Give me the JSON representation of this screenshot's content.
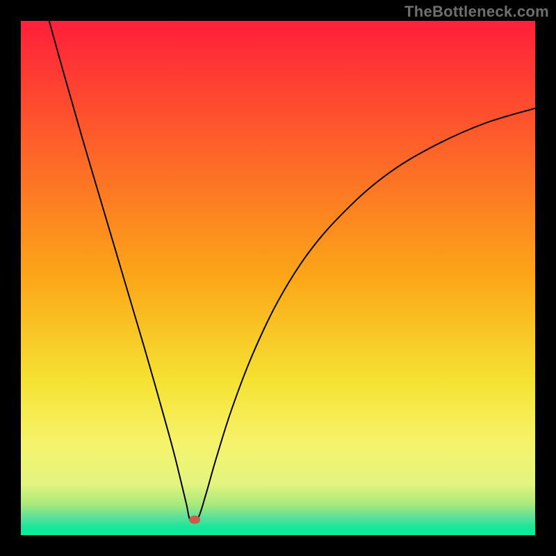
{
  "watermark": "TheBottleneck.com",
  "chart_data": {
    "type": "line",
    "title": "",
    "xlabel": "",
    "ylabel": "",
    "xlim": [
      0,
      100
    ],
    "ylim": [
      0,
      100
    ],
    "grid": false,
    "legend": false,
    "background_gradient": {
      "stops": [
        {
          "offset": 0.0,
          "color": "#ff1f3a"
        },
        {
          "offset": 0.5,
          "color": "#fca718"
        },
        {
          "offset": 0.7,
          "color": "#f5e232"
        },
        {
          "offset": 0.82,
          "color": "#f6f36b"
        },
        {
          "offset": 0.9,
          "color": "#e3f47f"
        },
        {
          "offset": 0.94,
          "color": "#a9e97c"
        },
        {
          "offset": 0.965,
          "color": "#5de09a"
        },
        {
          "offset": 0.985,
          "color": "#17e69b"
        },
        {
          "offset": 1.0,
          "color": "#05f09a"
        }
      ]
    },
    "marker": {
      "x": 33.8,
      "y": 3.0,
      "color": "#d05a4a",
      "rx": 8,
      "ry": 6
    },
    "series": [
      {
        "name": "bottleneck-curve",
        "type": "line",
        "color": "#000000",
        "stroke_width": 2,
        "data": [
          {
            "x": 5.5,
            "y": 100.0
          },
          {
            "x": 8.0,
            "y": 91.0
          },
          {
            "x": 12.0,
            "y": 77.0
          },
          {
            "x": 16.0,
            "y": 63.5
          },
          {
            "x": 20.0,
            "y": 50.0
          },
          {
            "x": 24.0,
            "y": 36.5
          },
          {
            "x": 27.0,
            "y": 26.0
          },
          {
            "x": 29.5,
            "y": 17.0
          },
          {
            "x": 31.0,
            "y": 11.0
          },
          {
            "x": 32.2,
            "y": 6.0
          },
          {
            "x": 32.8,
            "y": 3.2
          },
          {
            "x": 33.6,
            "y": 2.8
          },
          {
            "x": 34.6,
            "y": 3.6
          },
          {
            "x": 36.0,
            "y": 8.0
          },
          {
            "x": 38.0,
            "y": 15.0
          },
          {
            "x": 41.0,
            "y": 24.5
          },
          {
            "x": 45.0,
            "y": 35.0
          },
          {
            "x": 50.0,
            "y": 45.5
          },
          {
            "x": 56.0,
            "y": 55.0
          },
          {
            "x": 63.0,
            "y": 63.0
          },
          {
            "x": 71.0,
            "y": 70.0
          },
          {
            "x": 80.0,
            "y": 75.5
          },
          {
            "x": 90.0,
            "y": 80.0
          },
          {
            "x": 100.0,
            "y": 83.0
          }
        ]
      }
    ]
  }
}
